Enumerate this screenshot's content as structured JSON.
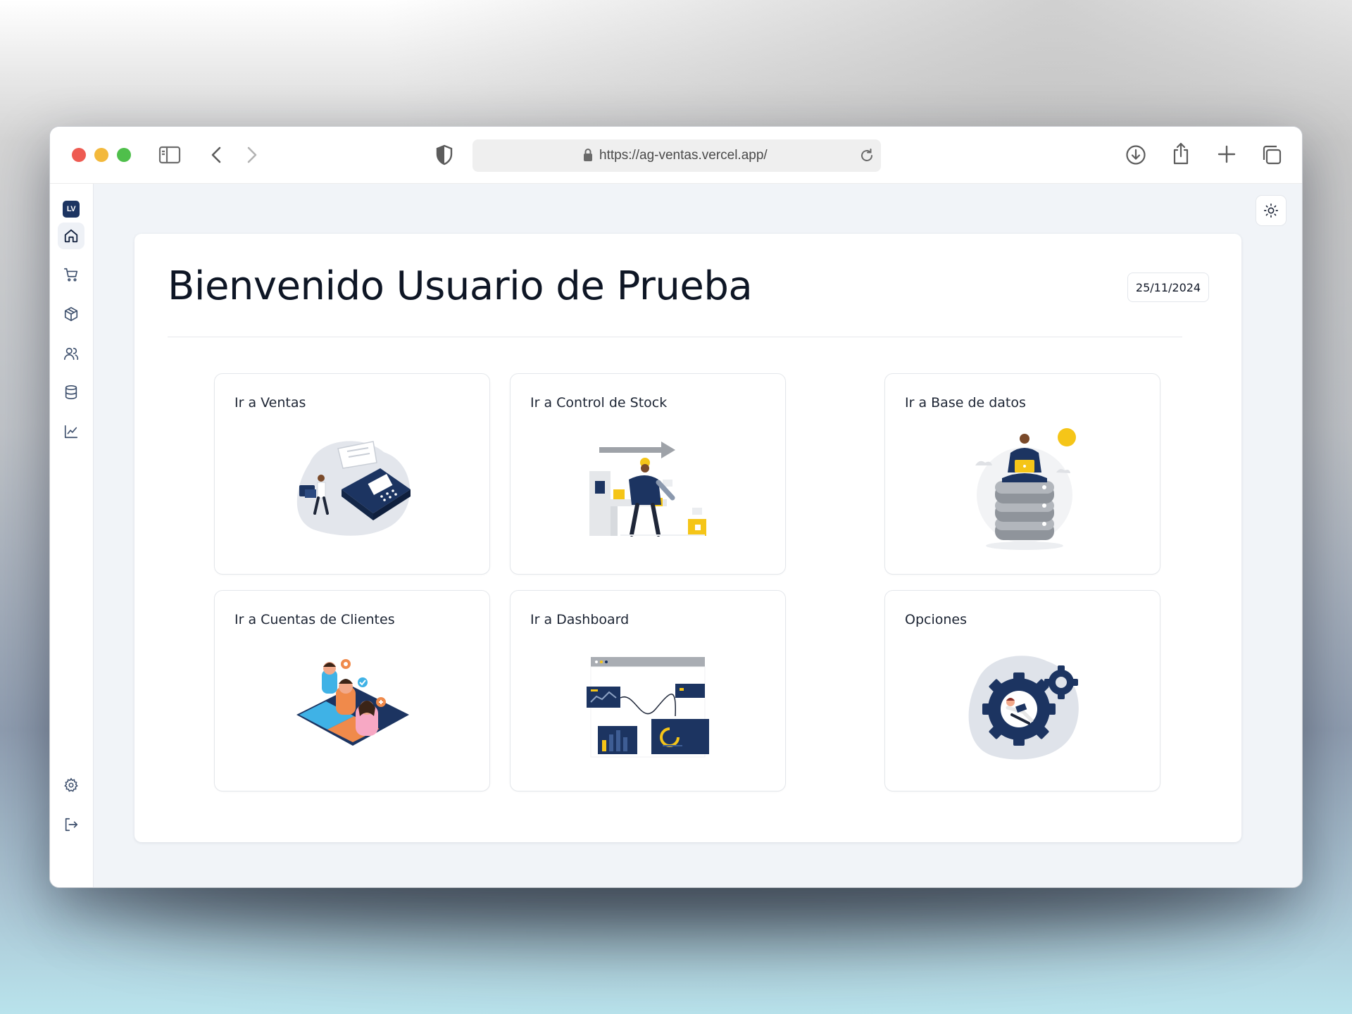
{
  "browser": {
    "url": "https://ag-ventas.vercel.app/"
  },
  "sidebar": {
    "logo_text": "LV",
    "items": [
      {
        "icon": "home-icon",
        "active": true
      },
      {
        "icon": "cart-icon",
        "active": false
      },
      {
        "icon": "box-icon",
        "active": false
      },
      {
        "icon": "users-icon",
        "active": false
      },
      {
        "icon": "database-icon",
        "active": false
      },
      {
        "icon": "chart-line-icon",
        "active": false
      }
    ],
    "bottom_items": [
      {
        "icon": "gear-icon"
      },
      {
        "icon": "logout-icon"
      }
    ]
  },
  "header": {
    "title": "Bienvenido Usuario de Prueba",
    "date": "25/11/2024",
    "theme_icon": "sun-icon"
  },
  "tiles": [
    {
      "label": "Ir a Ventas",
      "illustration": "payment-terminal-illustration"
    },
    {
      "label": "Ir a Control de Stock",
      "illustration": "warehouse-worker-illustration"
    },
    {
      "label": "Ir a Base de datos",
      "illustration": "database-server-illustration"
    },
    {
      "label": "Ir a Cuentas de Clientes",
      "illustration": "customer-profiles-illustration"
    },
    {
      "label": "Ir a Dashboard",
      "illustration": "dashboard-charts-illustration"
    },
    {
      "label": "Opciones",
      "illustration": "settings-gears-illustration"
    }
  ],
  "colors": {
    "navy": "#1c3461",
    "accent_yellow": "#f5c518",
    "page_bg": "#f1f4f8"
  }
}
